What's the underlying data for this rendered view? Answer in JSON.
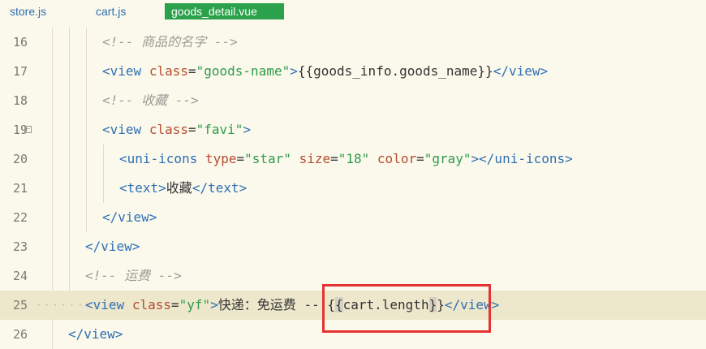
{
  "tabs": [
    {
      "label": "store.js",
      "active": false
    },
    {
      "label": "cart.js",
      "active": false
    },
    {
      "label": "goods_detail.vue",
      "active": true
    }
  ],
  "lines": [
    {
      "n": "16",
      "p1": "<!-- ",
      "p2": "商品的名字",
      "p3": " -->"
    },
    {
      "n": "17",
      "t1": "<view",
      "a1": "class",
      "e1": "=",
      "s1": "\"goods-name\"",
      "t2": ">",
      "x1": "{{goods_info.goods_name}}",
      "t3": "</view>"
    },
    {
      "n": "18",
      "p1": "<!-- ",
      "p2": "收藏",
      "p3": " -->"
    },
    {
      "n": "19",
      "t1": "<view",
      "a1": "class",
      "e1": "=",
      "s1": "\"favi\"",
      "t2": ">"
    },
    {
      "n": "20",
      "t1": "<uni-icons",
      "a1": "type",
      "s1": "\"star\"",
      "a2": "size",
      "s2": "\"18\"",
      "a3": "color",
      "s3": "\"gray\"",
      "t2": "></uni-icons>",
      "e": "="
    },
    {
      "n": "21",
      "t1": "<text>",
      "x1": "收藏",
      "t2": "</text>"
    },
    {
      "n": "22",
      "t1": "</view>"
    },
    {
      "n": "23",
      "t1": "</view>"
    },
    {
      "n": "24",
      "p1": "<!-- ",
      "p2": "运费",
      "p3": " -->"
    },
    {
      "n": "25",
      "t1": "<view",
      "a1": "class",
      "e1": "=",
      "s1": "\"yf\"",
      "t2": ">",
      "x1": "快递：免运费 ",
      "x2": "-- {",
      "b1": "{",
      "x3": "cart.length",
      "b2": "}",
      "x4": "}",
      "t3": "</view>"
    },
    {
      "n": "26",
      "t1": "</view>"
    }
  ],
  "highlight_color": "#e53232",
  "active_tab_color": "#2aa14a"
}
